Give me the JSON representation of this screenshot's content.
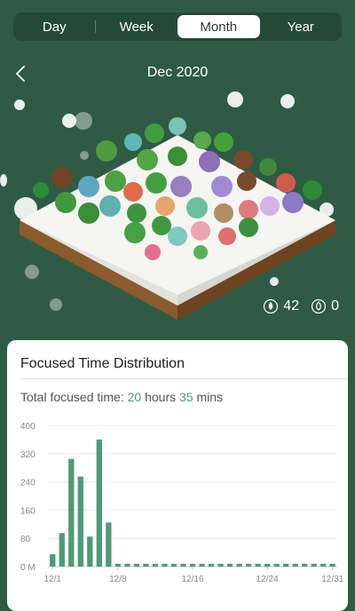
{
  "tabs": [
    {
      "label": "Day",
      "active": false
    },
    {
      "label": "Week",
      "active": false
    },
    {
      "label": "Month",
      "active": true
    },
    {
      "label": "Year",
      "active": false
    }
  ],
  "header": {
    "title": "Dec 2020"
  },
  "forest": {
    "healthy_trees": "42",
    "dead_trees": "0"
  },
  "card": {
    "title": "Focused Time Distribution",
    "total_label": "Total focused time:",
    "hours": "20",
    "hours_unit": "hours",
    "mins": "35",
    "mins_unit": "mins"
  },
  "colors": {
    "accent": "#4e9b74",
    "background": "#2f5b44"
  },
  "chart_data": {
    "type": "bar",
    "x": [
      1,
      2,
      3,
      4,
      5,
      6,
      7,
      8,
      9,
      10,
      11,
      12,
      13,
      14,
      15,
      16,
      17,
      18,
      19,
      20,
      21,
      22,
      23,
      24,
      25,
      26,
      27,
      28,
      29,
      30,
      31
    ],
    "values": [
      35,
      95,
      305,
      255,
      85,
      360,
      125,
      8,
      8,
      8,
      8,
      8,
      8,
      8,
      8,
      8,
      8,
      8,
      8,
      8,
      8,
      8,
      8,
      8,
      8,
      8,
      8,
      8,
      8,
      8,
      8
    ],
    "yticks": [
      "0 M",
      "80",
      "160",
      "240",
      "320",
      "400"
    ],
    "ytick_values": [
      0,
      80,
      160,
      240,
      320,
      400
    ],
    "xticks": [
      {
        "day": 1,
        "label": "12/1"
      },
      {
        "day": 8,
        "label": "12/8"
      },
      {
        "day": 16,
        "label": "12/16"
      },
      {
        "day": 24,
        "label": "12/24"
      },
      {
        "day": 31,
        "label": "12/31"
      }
    ],
    "ylim": [
      0,
      400
    ],
    "grid": true
  }
}
